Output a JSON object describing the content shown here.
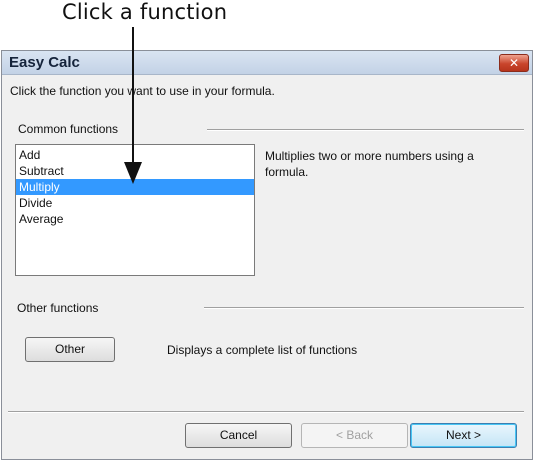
{
  "callout": {
    "text": "Click a function"
  },
  "window": {
    "title": "Easy Calc",
    "close_glyph": "✕",
    "instruction": "Click the function you want to use in your formula."
  },
  "common": {
    "group_label": "Common functions",
    "items": [
      {
        "label": "Add",
        "selected": false
      },
      {
        "label": "Subtract",
        "selected": false
      },
      {
        "label": "Multiply",
        "selected": true
      },
      {
        "label": "Divide",
        "selected": false
      },
      {
        "label": "Average",
        "selected": false
      }
    ],
    "description": "Multiplies two or more numbers using a formula."
  },
  "other": {
    "group_label": "Other functions",
    "button_label": "Other",
    "description": "Displays a complete list of functions"
  },
  "footer": {
    "cancel_label": "Cancel",
    "back_label": "< Back",
    "next_label": "Next >"
  },
  "colors": {
    "selection": "#3399ff",
    "close_button": "#c9452c"
  }
}
